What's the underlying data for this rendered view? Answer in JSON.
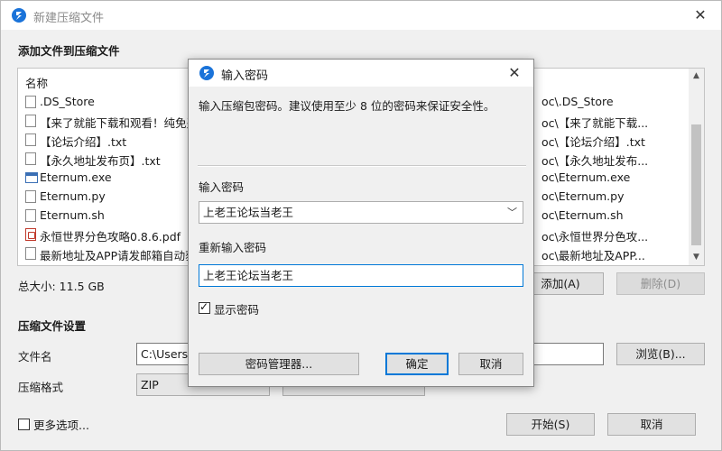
{
  "main": {
    "title": "新建压缩文件",
    "add_section_title": "添加文件到压缩文件",
    "file_list": {
      "column_name": "名称",
      "files": [
        {
          "name": ".DS_Store",
          "type": "file"
        },
        {
          "name": "【来了就能下载和观看！纯免费",
          "type": "file"
        },
        {
          "name": "【论坛介绍】.txt",
          "type": "file"
        },
        {
          "name": "【永久地址发布页】.txt",
          "type": "file"
        },
        {
          "name": "Eternum.exe",
          "type": "exe"
        },
        {
          "name": "Eternum.py",
          "type": "file"
        },
        {
          "name": "Eternum.sh",
          "type": "file"
        },
        {
          "name": "永恒世界分色攻略0.8.6.pdf",
          "type": "pdf"
        },
        {
          "name": "最新地址及APP请发邮箱自动获",
          "type": "file"
        }
      ],
      "paths": [
        "oc\\.DS_Store",
        "oc\\【来了就能下载...",
        "oc\\【论坛介绍】.txt",
        "oc\\【永久地址发布...",
        "oc\\Eternum.exe",
        "oc\\Eternum.py",
        "oc\\Eternum.sh",
        "oc\\永恒世界分色攻...",
        "oc\\最新地址及APP..."
      ]
    },
    "total_size": "总大小: 11.5 GB",
    "add_button": "添加(A)",
    "delete_button": "删除(D)",
    "settings_title": "压缩文件设置",
    "filename_label": "文件名",
    "filename_value": "C:\\Users\\",
    "browse_button": "浏览(B)...",
    "format_label": "压缩格式",
    "format_value": "ZIP",
    "more_options": "更多选项...",
    "start_button": "开始(S)",
    "cancel_button": "取消"
  },
  "dialog": {
    "title": "输入密码",
    "hint": "输入压缩包密码。建议使用至少 8 位的密码来保证安全性。",
    "password_label": "输入密码",
    "password_value": "上老王论坛当老王",
    "reenter_label": "重新输入密码",
    "reenter_value": "上老王论坛当老王",
    "show_password_label": "显示密码",
    "show_password_checked": true,
    "manager_button": "密码管理器...",
    "ok_button": "确定",
    "cancel_button": "取消"
  },
  "colors": {
    "accent": "#0078d7",
    "app_icon": "#1a73d9",
    "window_bg": "#f0f0f0"
  }
}
